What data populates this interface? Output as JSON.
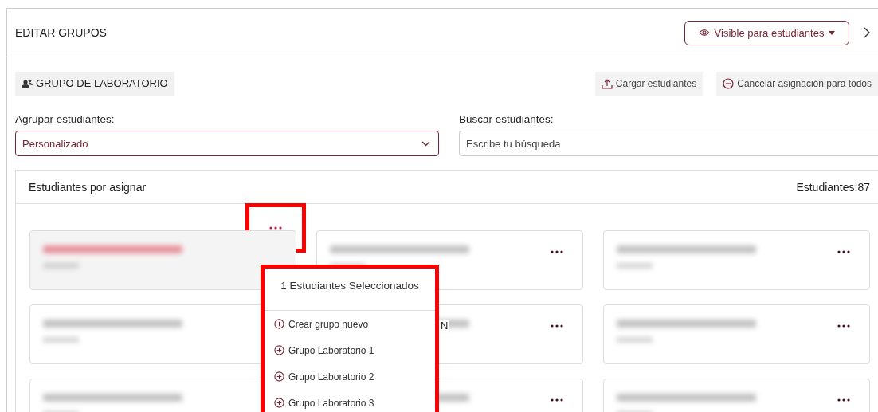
{
  "header": {
    "title": "EDITAR GRUPOS",
    "visibility_button": "Visible para estudiantes"
  },
  "group_chip": "GRUPO DE LABORATORIO",
  "actions": [
    {
      "kind": "upload",
      "label": "Cargar estudiantes"
    },
    {
      "kind": "cancel",
      "label": "Cancelar asignación para todos"
    }
  ],
  "group_select": {
    "label": "Agrupar estudiantes:",
    "value": "Personalizado"
  },
  "search": {
    "label": "Buscar estudiantes:",
    "placeholder": "Escribe tu búsqueda"
  },
  "panel": {
    "title": "Estudiantes por asignar",
    "count": "Estudiantes:87",
    "cards": [
      {
        "selected": true
      },
      {
        "selected": false
      },
      {
        "selected": false
      },
      {
        "selected": false
      },
      {
        "selected": false,
        "name_tail": "N"
      },
      {
        "selected": false
      },
      {
        "selected": false
      },
      {
        "selected": false
      },
      {
        "selected": false
      }
    ],
    "menu": {
      "title": "1 Estudiantes Seleccionados",
      "items": [
        "Crear grupo nuevo",
        "Grupo Laboratorio 1",
        "Grupo Laboratorio 2",
        "Grupo Laboratorio 3"
      ]
    }
  }
}
